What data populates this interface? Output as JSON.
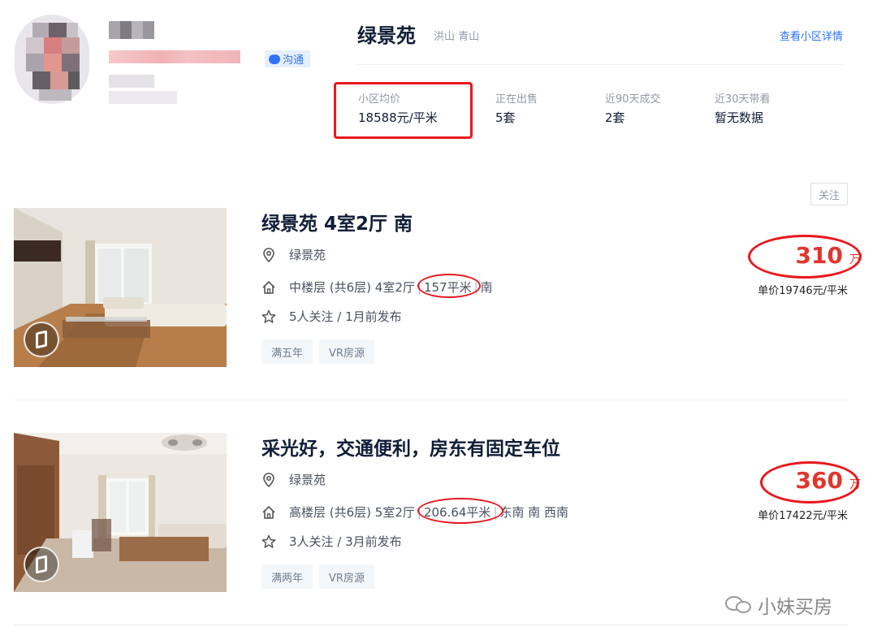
{
  "agent": {
    "chat_label": "沟通",
    "colors": {
      "chat_bg": "#e6f0fc",
      "chat_text": "#3072f6"
    }
  },
  "community": {
    "name": "绿景苑",
    "location": "洪山 青山",
    "detail_link": "查看小区详情",
    "stats": [
      {
        "label": "小区均价",
        "value": "18588元/平米"
      },
      {
        "label": "正在出售",
        "value": "5套"
      },
      {
        "label": "近90天成交",
        "value": "2套"
      },
      {
        "label": "近30天带看",
        "value": "暂无数据"
      }
    ]
  },
  "follow_label": "关注",
  "listings": [
    {
      "title": "绿景苑 4室2厅 南",
      "community": "绿景苑",
      "floor_info": "中楼层 (共6层) 4室2厅",
      "area": "157平米",
      "orientation": "南",
      "followers": "5人关注 / 1月前发布",
      "tags": [
        "满五年",
        "VR房源"
      ],
      "price": "310",
      "price_unit": "万",
      "unit_price": "单价19746元/平米"
    },
    {
      "title": "采光好，交通便利，房东有固定车位",
      "community": "绿景苑",
      "floor_info": "高楼层 (共6层) 5室2厅",
      "area": "206.64平米",
      "orientation": "东南 南 西南",
      "followers": "3人关注 / 3月前发布",
      "tags": [
        "满两年",
        "VR房源"
      ],
      "price": "360",
      "price_unit": "万",
      "unit_price": "单价17422元/平米"
    }
  ],
  "watermark": "小妹买房",
  "colors": {
    "price": "#e0362c",
    "highlight": "#e8181d",
    "title": "#101d37",
    "link": "#3072f6"
  }
}
